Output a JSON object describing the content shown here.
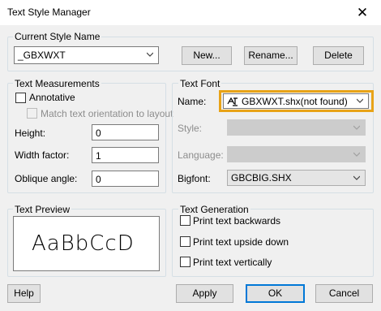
{
  "window": {
    "title": "Text Style Manager",
    "close_glyph": "✕"
  },
  "current_style": {
    "group_label": "Current Style Name",
    "value": "_GBXWXT",
    "buttons": {
      "new": "New...",
      "rename": "Rename...",
      "delete": "Delete"
    }
  },
  "measurements": {
    "group_label": "Text Measurements",
    "annotative_label": "Annotative",
    "annotative_checked": false,
    "match_orientation_label": "Match text orientation to layout",
    "height_label": "Height:",
    "height_value": "0",
    "width_factor_label": "Width factor:",
    "width_factor_value": "1",
    "oblique_label": "Oblique angle:",
    "oblique_value": "0"
  },
  "font": {
    "group_label": "Text Font",
    "name_label": "Name:",
    "name_value": "GBXWXT.shx(not found)",
    "name_icon": "shx-font-icon",
    "style_label": "Style:",
    "style_value": "",
    "language_label": "Language:",
    "language_value": "",
    "bigfont_label": "Bigfont:",
    "bigfont_value": "GBCBIG.SHX"
  },
  "preview": {
    "group_label": "Text Preview",
    "sample": "AaBbCcD"
  },
  "generation": {
    "group_label": "Text Generation",
    "backwards_label": "Print text backwards",
    "upside_down_label": "Print text upside down",
    "vertically_label": "Print text vertically"
  },
  "footer": {
    "help": "Help",
    "apply": "Apply",
    "ok": "OK",
    "cancel": "Cancel"
  },
  "colors": {
    "highlight": "#e8a317",
    "accent": "#0078d7"
  }
}
